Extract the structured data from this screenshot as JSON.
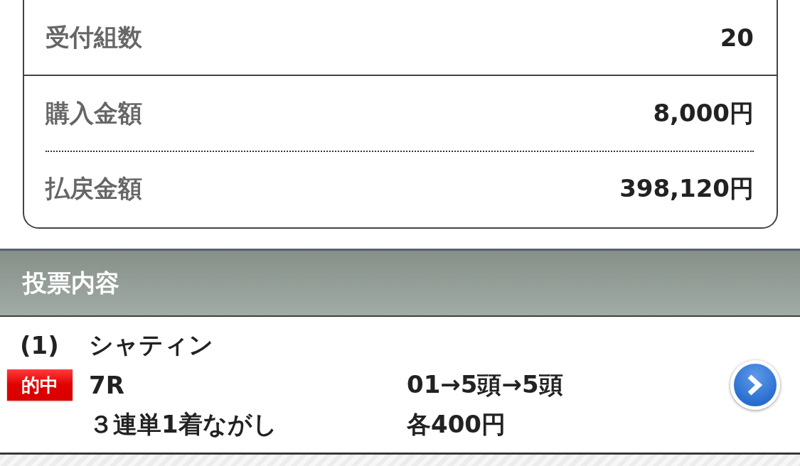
{
  "summary": {
    "groups": [
      {
        "rows": [
          {
            "label": "受付組数",
            "value": "20"
          }
        ]
      },
      {
        "rows": [
          {
            "label": "購入金額",
            "value": "8,000円"
          },
          {
            "label": "払戻金額",
            "value": "398,120円"
          }
        ]
      }
    ]
  },
  "section": {
    "title": "投票内容"
  },
  "bets": [
    {
      "number": "(1)",
      "venue": "シャティン",
      "hit": true,
      "badge": "的中",
      "race": "7R",
      "bet_type": "３連単1着ながし",
      "combination": "01→5頭→5頭",
      "amount": "各400円"
    }
  ]
}
